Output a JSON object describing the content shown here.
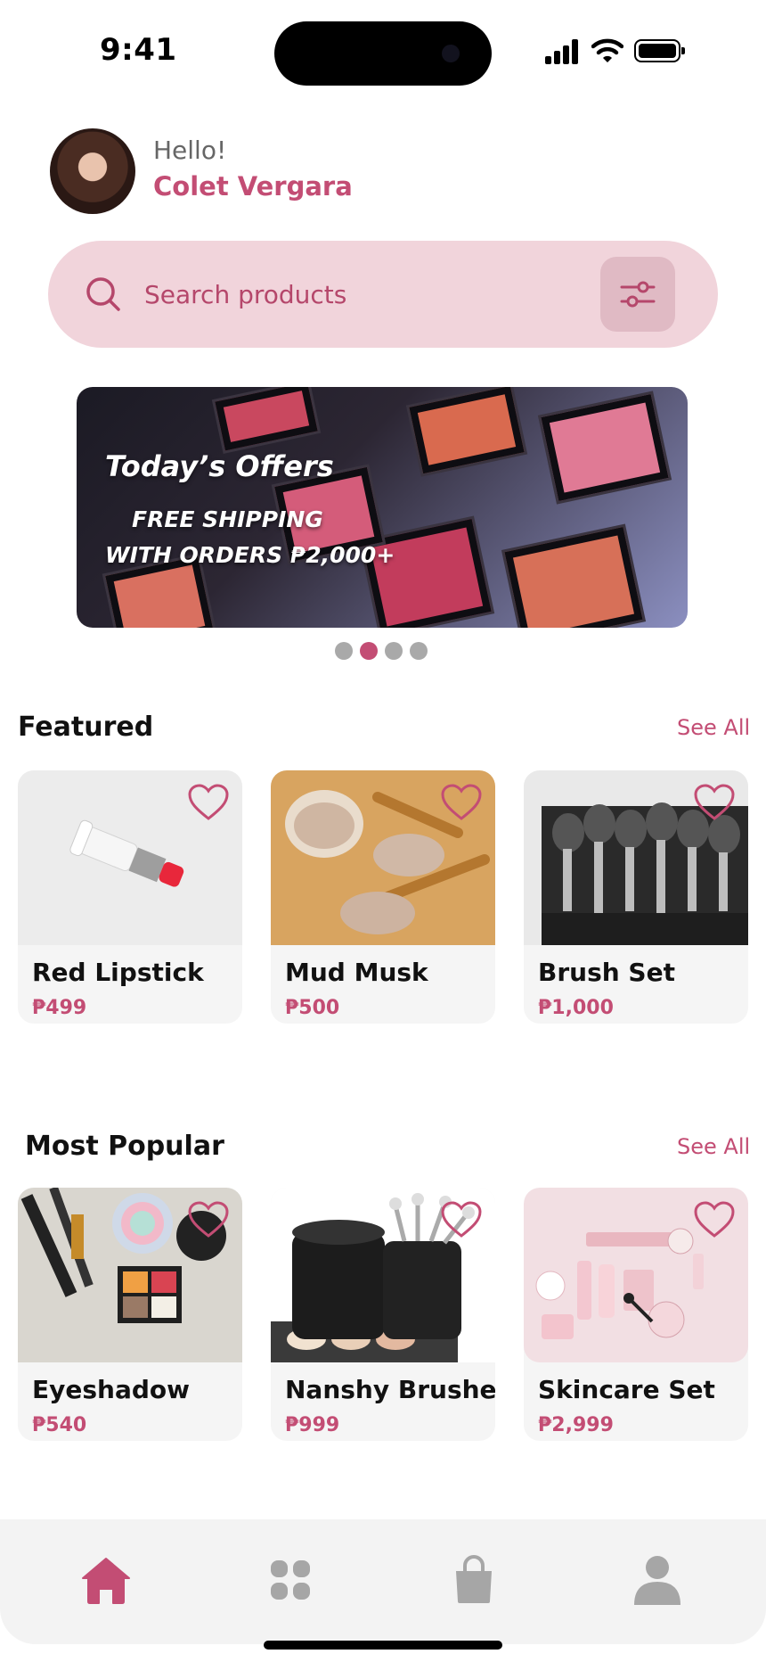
{
  "status": {
    "time": "9:41"
  },
  "user": {
    "greeting": "Hello!",
    "name": "Colet Vergara"
  },
  "search": {
    "placeholder": "Search products"
  },
  "banner": {
    "title": "Today’s Offers",
    "line1": "FREE SHIPPING",
    "line2": "WITH ORDERS ₱2,000+",
    "page_count": 4,
    "active_page": 2
  },
  "featured": {
    "title": "Featured",
    "see_all": "See All",
    "items": [
      {
        "name": "Red Lipstick",
        "price": "₱499"
      },
      {
        "name": "Mud Musk",
        "price": "₱500"
      },
      {
        "name": "Brush Set",
        "price": "₱1,000"
      }
    ]
  },
  "popular": {
    "title": "Most Popular",
    "see_all": "See All",
    "items": [
      {
        "name": "Eyeshadow",
        "price": "₱540"
      },
      {
        "name": "Nanshy Brushes",
        "price": "₱999"
      },
      {
        "name": "Skincare Set",
        "price": "₱2,999"
      }
    ]
  },
  "nav": {
    "active": "home-icon"
  },
  "colors": {
    "accent": "#c34d74",
    "search_bg": "#f1d4db",
    "inactive_icon": "#a6a6a6"
  }
}
